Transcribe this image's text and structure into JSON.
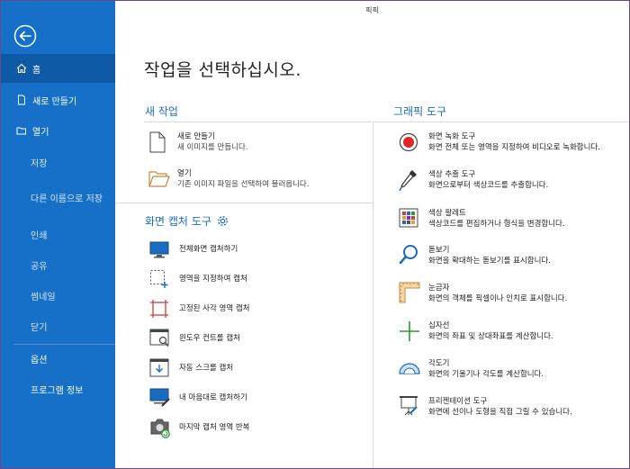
{
  "window": {
    "title": "픽픽"
  },
  "sidebar": {
    "items": [
      {
        "label": "홈"
      },
      {
        "label": "새로 만들기"
      },
      {
        "label": "열기"
      },
      {
        "label": "저장"
      },
      {
        "label": "다른 이름으로 저장"
      },
      {
        "label": "인쇄"
      },
      {
        "label": "공유"
      },
      {
        "label": "썸네일"
      },
      {
        "label": "닫기"
      },
      {
        "label": "옵션"
      },
      {
        "label": "프로그램 정보"
      }
    ]
  },
  "main": {
    "heading": "작업을 선택하십시오.",
    "new_task": {
      "title": "새 작업",
      "items": [
        {
          "title": "새로 만들기",
          "desc": "새 이미지를 만듭니다.",
          "icon": "new-file-icon"
        },
        {
          "title": "열기",
          "desc": "기존 이미지 파일을 선택하여 불러옵니다.",
          "icon": "open-folder-icon"
        }
      ]
    },
    "capture": {
      "title": "화면 캡처 도구",
      "items": [
        {
          "label": "전체화면 캡처하기",
          "icon": "fullscreen-capture-icon"
        },
        {
          "label": "영역을 지정하여 캡처",
          "icon": "region-capture-icon"
        },
        {
          "label": "고정된 사각 영역 캡처",
          "icon": "fixed-region-icon"
        },
        {
          "label": "윈도우 컨트롤 캡처",
          "icon": "window-control-icon"
        },
        {
          "label": "자동 스크롤 캡처",
          "icon": "auto-scroll-icon"
        },
        {
          "label": "내 마음대로 캡처하기",
          "icon": "freehand-capture-icon"
        },
        {
          "label": "마지막 캡처 영역 반복",
          "icon": "repeat-capture-icon"
        }
      ]
    },
    "graphics": {
      "title": "그래픽 도구",
      "items": [
        {
          "title": "화면 녹화 도구",
          "desc": "화면 전체 또는 영역을 지정하여 비디오로 녹화합니다.",
          "icon": "record-icon"
        },
        {
          "title": "색상 추출 도구",
          "desc": "화면으로부터 색상코드를 추출합니다.",
          "icon": "eyedropper-icon"
        },
        {
          "title": "색상 팔레트",
          "desc": "색상코드를 편집하거나 형식을 변경합니다.",
          "icon": "palette-icon"
        },
        {
          "title": "돋보기",
          "desc": "화면을 확대하는 돋보기를 표시합니다.",
          "icon": "magnifier-icon"
        },
        {
          "title": "눈금자",
          "desc": "화면의 객체를 픽셀이나 인치로 표시합니다.",
          "icon": "ruler-icon"
        },
        {
          "title": "십자선",
          "desc": "화면의 좌표 및 상대좌표를 계산합니다.",
          "icon": "crosshair-icon"
        },
        {
          "title": "각도기",
          "desc": "화면의 기울기나 각도를 계산합니다.",
          "icon": "protractor-icon"
        },
        {
          "title": "프리젠테이션 도구",
          "desc": "화면에 선이나 도형을 직접 그릴 수 있습니다.",
          "icon": "presentation-icon"
        }
      ]
    }
  },
  "colors": {
    "sidebar": "#1670c8",
    "accent": "#1a6cc0",
    "selected": "#0f5aa7"
  }
}
